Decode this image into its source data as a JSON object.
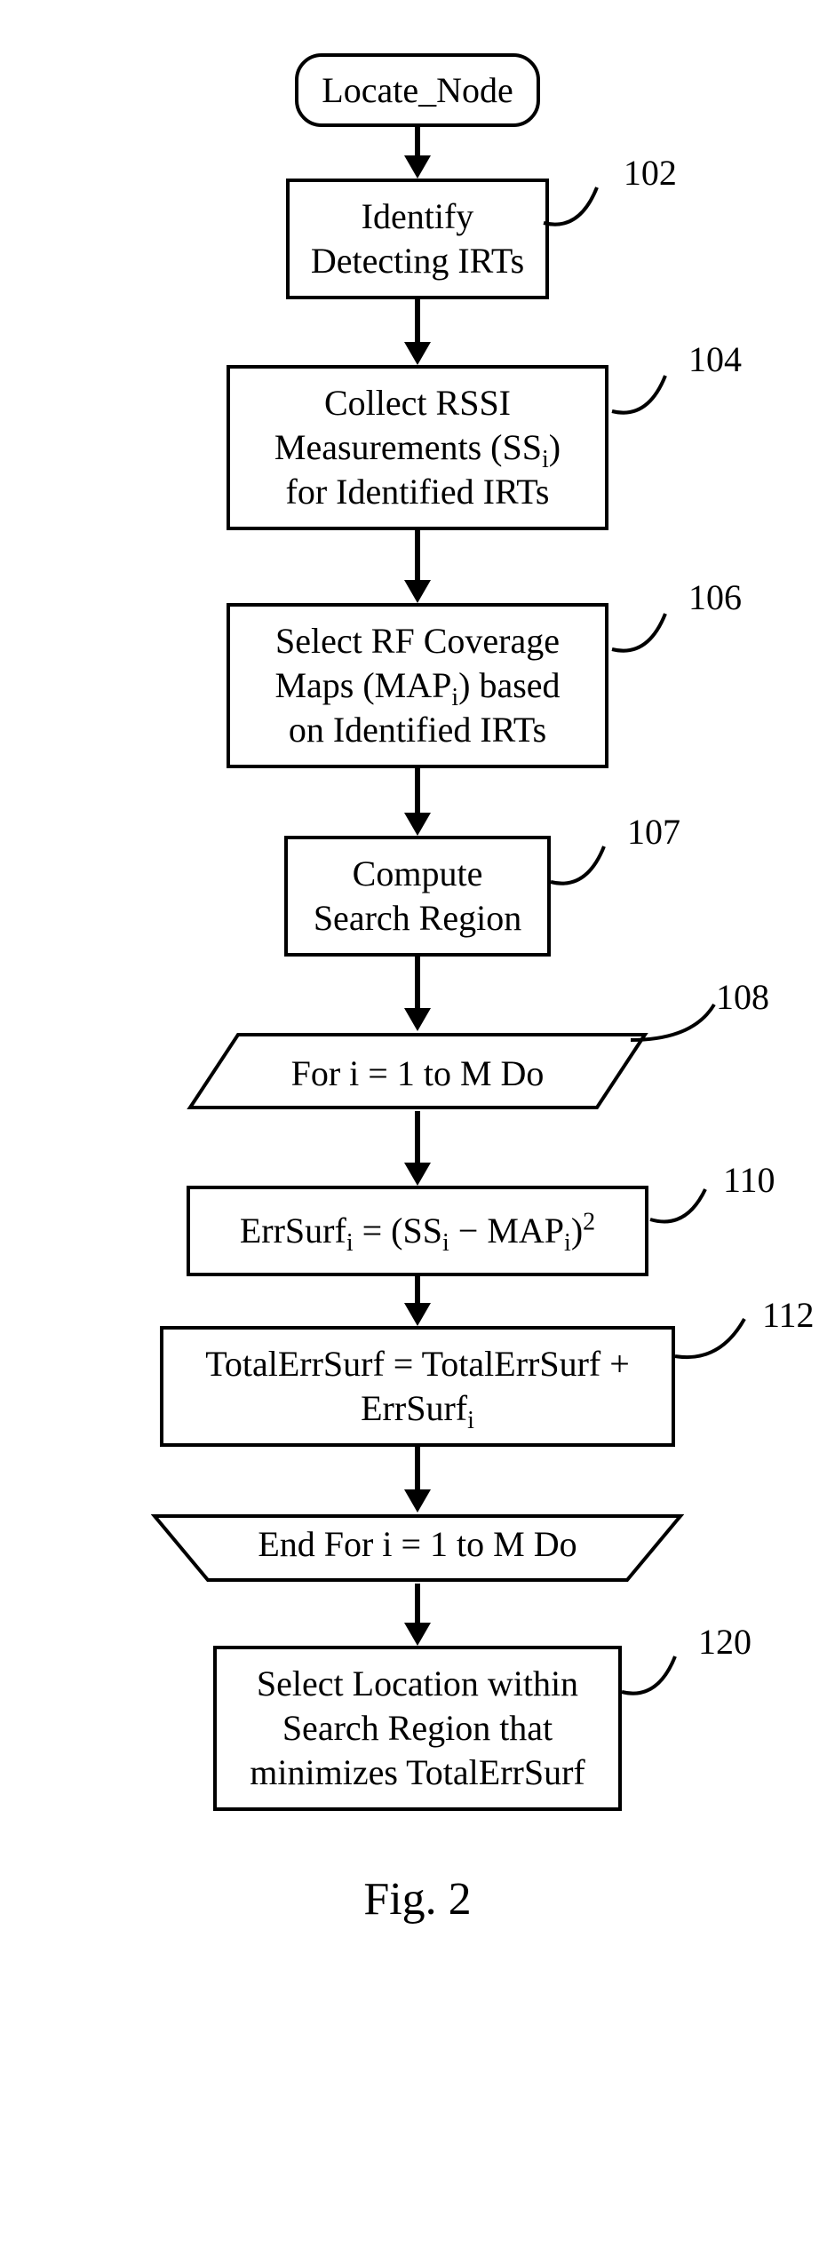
{
  "start": {
    "label": "Locate_Node"
  },
  "steps": {
    "identify": {
      "text": "Identify\nDetecting IRTs",
      "ref": "102"
    },
    "collect": {
      "text": "Collect RSSI\nMeasurements (SS<sub>i</sub>)\nfor Identified IRTs",
      "ref": "104"
    },
    "selectmaps": {
      "text": "Select RF Coverage\nMaps (MAP<sub>i</sub>) based\non Identified IRTs",
      "ref": "106"
    },
    "compute": {
      "text": "Compute\nSearch Region",
      "ref": "107"
    },
    "loopstart": {
      "text": "For i = 1 to M Do",
      "ref": "108"
    },
    "errsurf": {
      "text": "ErrSurf<sub>i</sub> = (SS<sub>i</sub> − MAP<sub>i</sub>)<sup>2</sup>",
      "ref": "110"
    },
    "total": {
      "text": "TotalErrSurf = TotalErrSurf +\nErrSurf<sub>i</sub>",
      "ref": "112"
    },
    "loopend": {
      "text": "End For i = 1 to M Do"
    },
    "selectloc": {
      "text": "Select Location within\nSearch Region that\nminimizes TotalErrSurf",
      "ref": "120"
    }
  },
  "caption": "Fig. 2"
}
